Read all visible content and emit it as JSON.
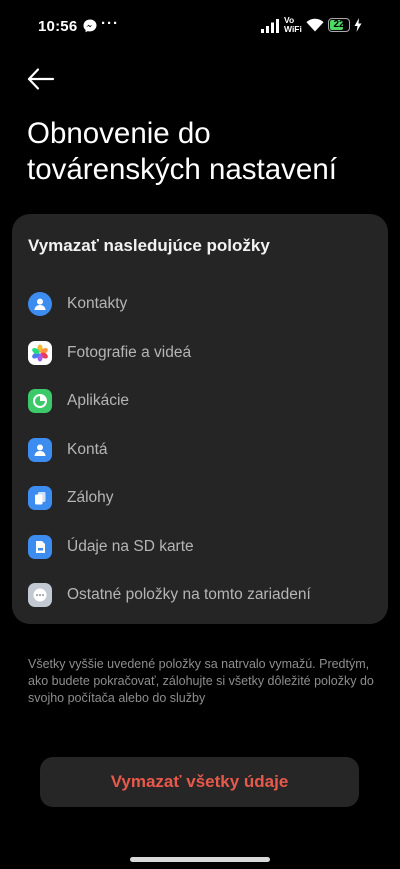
{
  "status_bar": {
    "time": "10:56",
    "more": "···",
    "vowifi_line1": "Vo",
    "vowifi_line2": "WiFi",
    "battery_level": "22",
    "icons": [
      "messenger-icon",
      "signal-icon",
      "wifi-icon",
      "battery-icon",
      "charging-bolt-icon"
    ]
  },
  "header": {
    "back_icon": "arrow-left-icon",
    "title": "Obnovenie do továrenských nastavení"
  },
  "card": {
    "heading": "Vymazať nasledujúce položky",
    "items": [
      {
        "label": "Kontakty",
        "icon": "contacts-icon",
        "color": "#3d8cf0"
      },
      {
        "label": "Fotografie a videá",
        "icon": "photos-icon",
        "color": "#ffffff"
      },
      {
        "label": "Aplikácie",
        "icon": "apps-icon",
        "color": "#3cc96a"
      },
      {
        "label": "Kontá",
        "icon": "accounts-icon",
        "color": "#3d8cf0"
      },
      {
        "label": "Zálohy",
        "icon": "backups-icon",
        "color": "#3d8cf0"
      },
      {
        "label": "Údaje na SD karte",
        "icon": "sd-card-icon",
        "color": "#3d8cf0"
      },
      {
        "label": "Ostatné položky na tomto zariadení",
        "icon": "other-items-icon",
        "color": "#c3c9d3"
      }
    ]
  },
  "footnote": "Všetky vyššie uvedené položky sa natrvalo vymažú. Predtým, ako budete pokračovať, zálohujte si všetky dôležité položky do svojho počítača alebo do služby",
  "action": {
    "label": "Vymazať všetky údaje",
    "color": "#e8594c"
  }
}
